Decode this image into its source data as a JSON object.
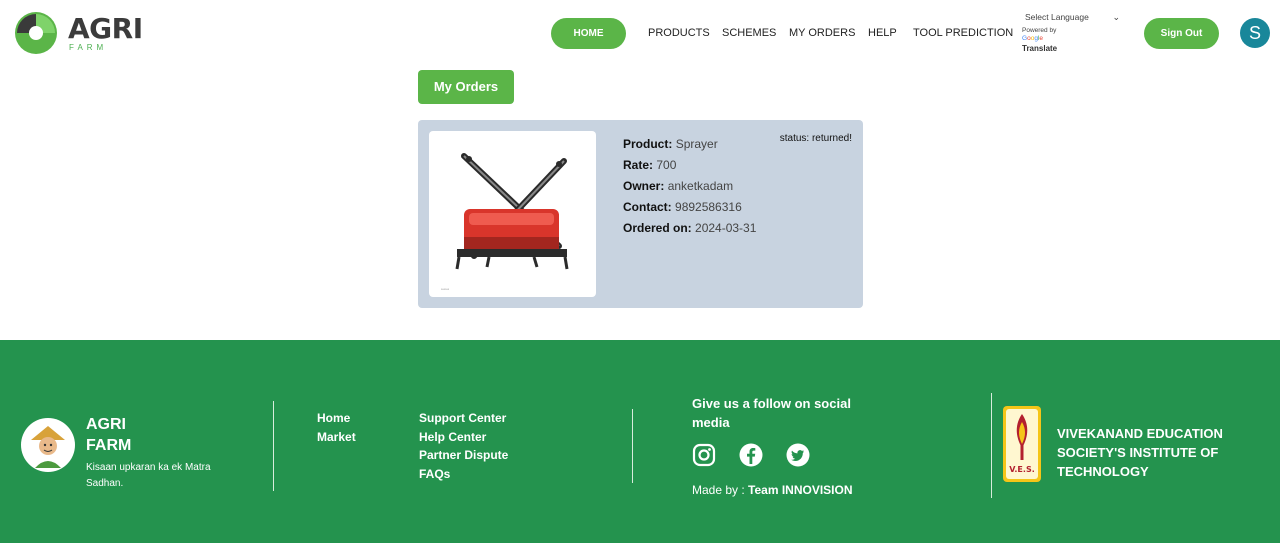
{
  "header": {
    "logo_title": "AGRI",
    "logo_subtitle": "FARM",
    "nav": {
      "home": "HOME",
      "products": "PRODUCTS",
      "schemes": "SCHEMES",
      "orders": "MY ORDERS",
      "help": "HELP",
      "tool_prediction": "TOOL PREDICTION"
    },
    "language": {
      "select_label": "Select Language",
      "powered_by": "Powered by",
      "google": "Google",
      "translate": "Translate"
    },
    "signout_label": "Sign Out",
    "avatar_initial": "S"
  },
  "main": {
    "my_orders_label": "My Orders",
    "order": {
      "product_key": "Product:",
      "product": "Sprayer",
      "rate_key": "Rate:",
      "rate": "700",
      "owner_key": "Owner:",
      "owner": "anketkadam",
      "contact_key": "Contact:",
      "contact": "9892586316",
      "ordered_on_key": "Ordered on:",
      "ordered_on": "2024-03-31",
      "status": "status: returned!"
    }
  },
  "footer": {
    "brand_line1": "AGRI",
    "brand_line2": "FARM",
    "tagline": "Kisaan upkaran ka ek Matra Sadhan.",
    "links_col1": [
      "Home",
      "Market"
    ],
    "links_col2": [
      "Support Center",
      "Help Center",
      "Partner Dispute",
      "FAQs"
    ],
    "social_title": "Give us a follow on social media",
    "social_icons": [
      "instagram-icon",
      "facebook-icon",
      "twitter-icon"
    ],
    "made_by_label": "Made by :",
    "made_by_team": "Team INNOVISION",
    "institute": "VIVEKANAND EDUCATION SOCIETY'S INSTITUTE OF TECHNOLOGY",
    "ves_logo_text": "V.E.S."
  },
  "colors": {
    "accent_green": "#5bb548",
    "footer_green": "#24934e",
    "card_bg": "#c8d3e0",
    "avatar_bg": "#19879a"
  }
}
